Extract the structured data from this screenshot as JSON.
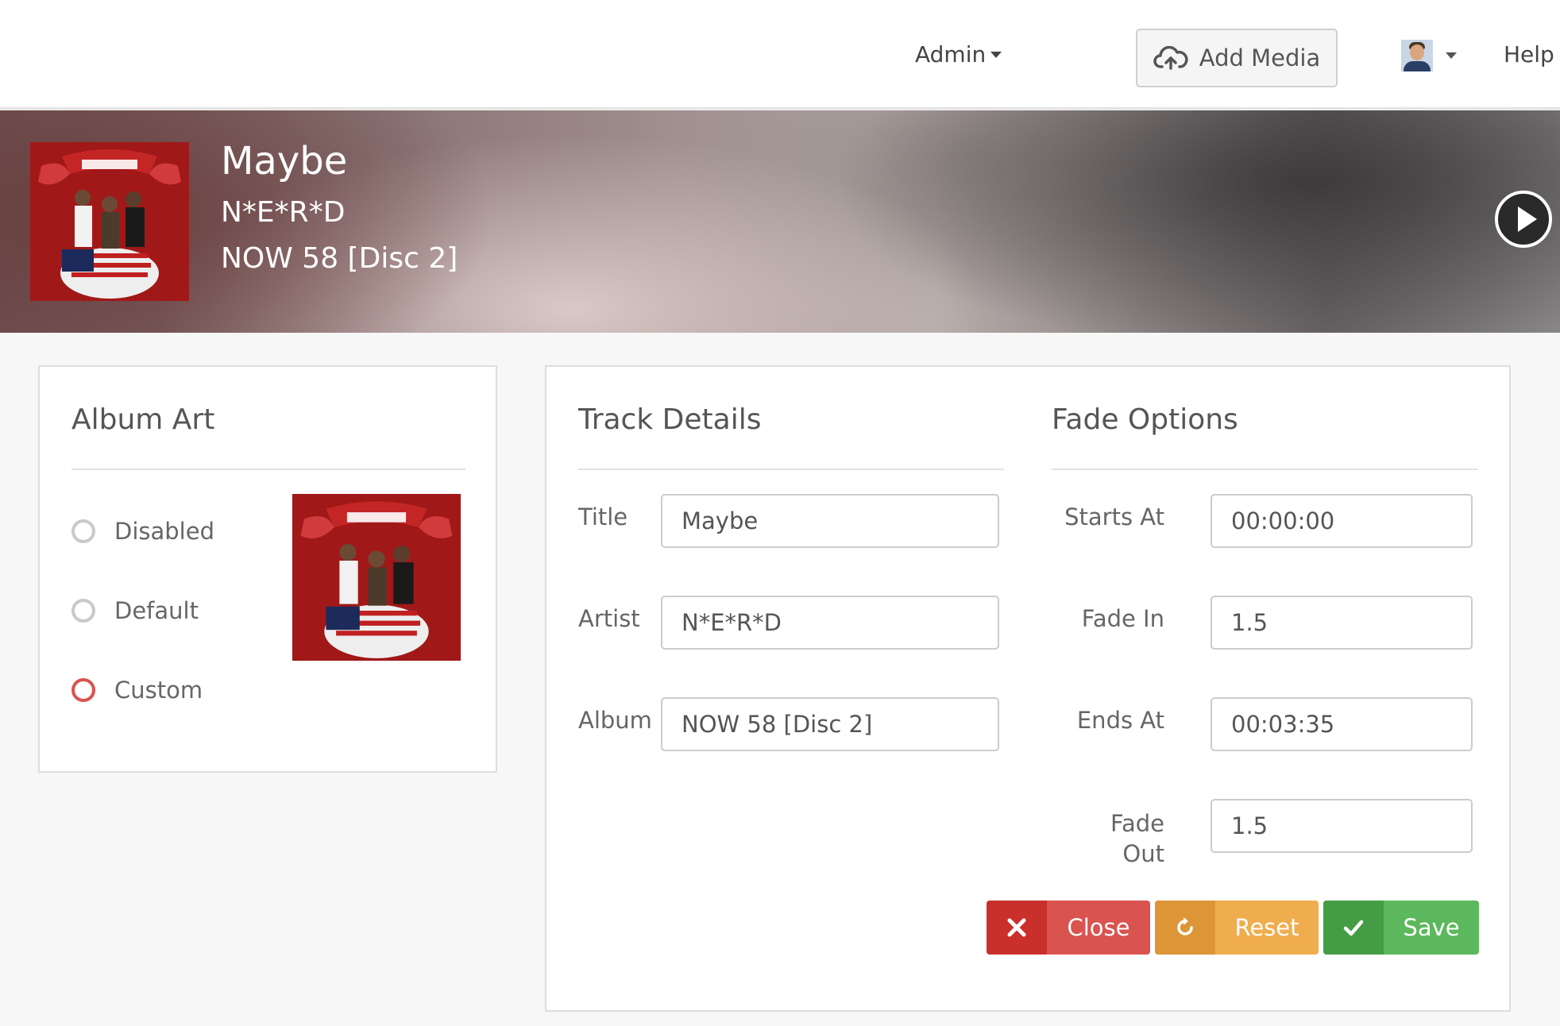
{
  "navbar": {
    "admin_label": "Admin",
    "add_media_label": "Add Media",
    "help_label": "Help"
  },
  "hero": {
    "title": "Maybe",
    "artist": "N*E*R*D",
    "album": "NOW 58 [Disc 2]"
  },
  "album_art": {
    "heading": "Album Art",
    "options": [
      {
        "label": "Disabled",
        "checked": false
      },
      {
        "label": "Default",
        "checked": false
      },
      {
        "label": "Custom",
        "checked": true
      }
    ]
  },
  "track_details": {
    "heading": "Track Details",
    "fields": [
      {
        "label": "Title",
        "value": "Maybe"
      },
      {
        "label": "Artist",
        "value": "N*E*R*D"
      },
      {
        "label": "Album",
        "value": "NOW 58 [Disc 2]"
      }
    ]
  },
  "fade_options": {
    "heading": "Fade Options",
    "fields": [
      {
        "label": "Starts At",
        "value": "00:00:00"
      },
      {
        "label": "Fade In",
        "value": "1.5"
      },
      {
        "label": "Ends At",
        "value": "00:03:35"
      },
      {
        "label": "Fade Out",
        "value": "1.5"
      }
    ]
  },
  "actions": {
    "close_label": "Close",
    "reset_label": "Reset",
    "save_label": "Save"
  },
  "colors": {
    "close": "#d9534f",
    "reset": "#f0ad4e",
    "save": "#5cb85c",
    "radio_selected": "#d9534f"
  }
}
